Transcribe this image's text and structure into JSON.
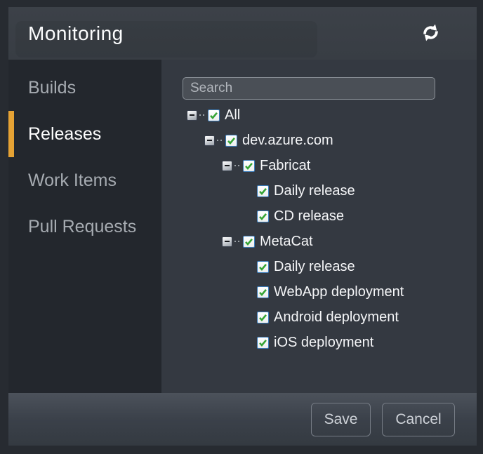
{
  "window": {
    "title": "Monitoring"
  },
  "header": {
    "refresh_icon": "refresh-sync-arrows"
  },
  "sidebar": {
    "items": [
      {
        "label": "Builds",
        "active": false
      },
      {
        "label": "Releases",
        "active": true
      },
      {
        "label": "Work Items",
        "active": false
      },
      {
        "label": "Pull Requests",
        "active": false
      }
    ]
  },
  "main": {
    "search": {
      "placeholder": "Search",
      "value": ""
    },
    "tree": [
      {
        "label": "All",
        "level": 0,
        "checked": true,
        "expanded": true
      },
      {
        "label": "dev.azure.com",
        "level": 1,
        "checked": true,
        "expanded": true
      },
      {
        "label": "Fabricat",
        "level": 2,
        "checked": true,
        "expanded": true
      },
      {
        "label": "Daily release",
        "level": 3,
        "checked": true,
        "leaf": true
      },
      {
        "label": "CD release",
        "level": 3,
        "checked": true,
        "leaf": true
      },
      {
        "label": "MetaCat",
        "level": 2,
        "checked": true,
        "expanded": true
      },
      {
        "label": "Daily release",
        "level": 3,
        "checked": true,
        "leaf": true
      },
      {
        "label": "WebApp deployment",
        "level": 3,
        "checked": true,
        "leaf": true
      },
      {
        "label": "Android deployment",
        "level": 3,
        "checked": true,
        "leaf": true
      },
      {
        "label": "iOS deployment",
        "level": 3,
        "checked": true,
        "leaf": true
      }
    ]
  },
  "footer": {
    "save_label": "Save",
    "cancel_label": "Cancel"
  },
  "colors": {
    "accent_orange": "#e5a234",
    "check_green": "#35a435",
    "checkbox_border_blue": "#3b7cba",
    "panel_bg": "#343941",
    "sidebar_bg": "#23272d",
    "header_bg": "#3a3f46"
  }
}
